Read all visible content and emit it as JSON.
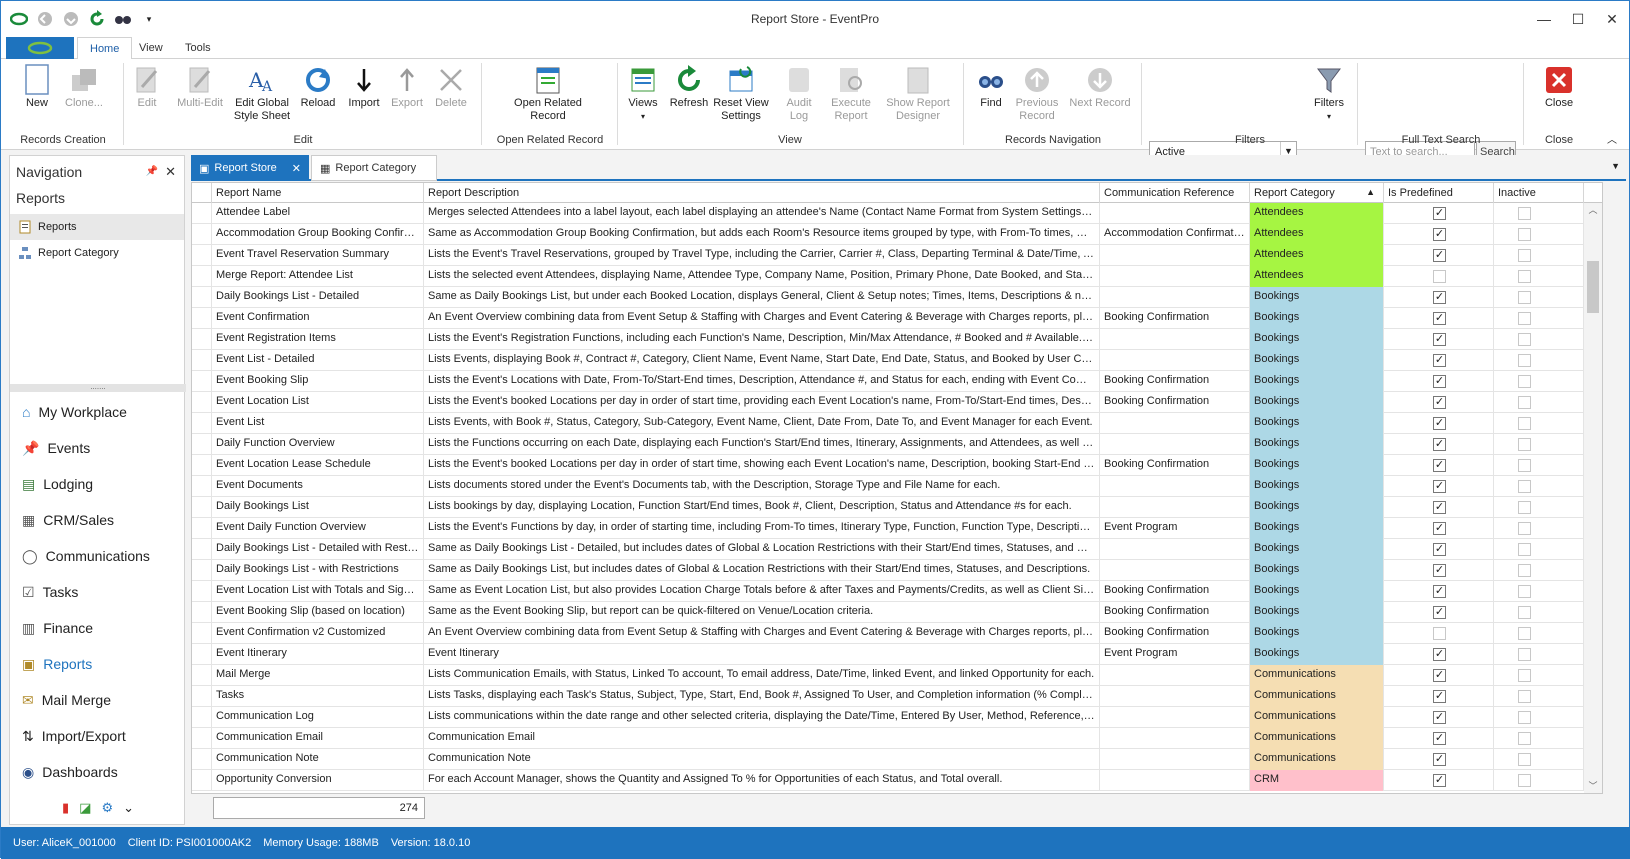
{
  "window": {
    "title": "Report Store - EventPro",
    "minimize": "—",
    "maximize": "☐",
    "close": "✕"
  },
  "menu": {
    "tabs": [
      "Home",
      "View",
      "Tools"
    ]
  },
  "ribbon": {
    "buttons": [
      {
        "key": "new",
        "label": "New",
        "disabled": false,
        "icon": "new-document-icon"
      },
      {
        "key": "clone",
        "label": "Clone...",
        "disabled": true,
        "icon": "clone-icon"
      },
      {
        "key": "edit",
        "label": "Edit",
        "disabled": true,
        "icon": "edit-icon"
      },
      {
        "key": "multi_edit",
        "label": "Multi-Edit",
        "disabled": true,
        "icon": "multi-edit-icon"
      },
      {
        "key": "edit_global",
        "label": "Edit Global Style Sheet",
        "disabled": false,
        "icon": "style-sheet-icon"
      },
      {
        "key": "reload",
        "label": "Reload",
        "disabled": false,
        "icon": "reload-icon"
      },
      {
        "key": "import",
        "label": "Import",
        "disabled": false,
        "icon": "import-icon"
      },
      {
        "key": "export",
        "label": "Export",
        "disabled": true,
        "icon": "export-icon"
      },
      {
        "key": "delete",
        "label": "Delete",
        "disabled": true,
        "icon": "delete-icon"
      },
      {
        "key": "open_related",
        "label": "Open Related Record",
        "disabled": false,
        "icon": "open-related-icon"
      },
      {
        "key": "views",
        "label": "Views",
        "disabled": false,
        "icon": "views-icon"
      },
      {
        "key": "refresh",
        "label": "Refresh",
        "disabled": false,
        "icon": "refresh-icon"
      },
      {
        "key": "reset_view",
        "label": "Reset View Settings",
        "disabled": false,
        "icon": "reset-view-icon"
      },
      {
        "key": "audit_log",
        "label": "Audit Log",
        "disabled": true,
        "icon": "audit-log-icon"
      },
      {
        "key": "execute_report",
        "label": "Execute Report",
        "disabled": true,
        "icon": "execute-report-icon"
      },
      {
        "key": "show_designer",
        "label": "Show Report Designer",
        "disabled": true,
        "icon": "report-designer-icon"
      },
      {
        "key": "find",
        "label": "Find",
        "disabled": false,
        "icon": "binoculars-icon"
      },
      {
        "key": "prev_record",
        "label": "Previous Record",
        "disabled": true,
        "icon": "up-arrow-icon"
      },
      {
        "key": "next_record",
        "label": "Next Record",
        "disabled": true,
        "icon": "down-arrow-icon"
      },
      {
        "key": "filters",
        "label": "Filters",
        "disabled": false,
        "icon": "funnel-icon"
      },
      {
        "key": "close",
        "label": "Close",
        "disabled": false,
        "icon": "close-icon"
      }
    ],
    "groups": [
      "Records Creation",
      "Edit",
      "Open Related Record",
      "View",
      "Records Navigation",
      "Filters",
      "Full Text Search",
      "Close"
    ],
    "filter_value": "Active",
    "search_placeholder": "Text to search...",
    "search_button": "Search"
  },
  "nav": {
    "title": "Navigation",
    "section": "Reports",
    "items": [
      {
        "label": "Reports",
        "icon": "report-icon"
      },
      {
        "label": "Report Category",
        "icon": "category-icon"
      }
    ],
    "modules": [
      {
        "label": "My Workplace",
        "icon": "home-icon"
      },
      {
        "label": "Events",
        "icon": "pin-icon"
      },
      {
        "label": "Lodging",
        "icon": "lodging-icon"
      },
      {
        "label": "CRM/Sales",
        "icon": "crm-icon"
      },
      {
        "label": "Communications",
        "icon": "speech-icon"
      },
      {
        "label": "Tasks",
        "icon": "tasks-icon"
      },
      {
        "label": "Finance",
        "icon": "finance-icon"
      },
      {
        "label": "Reports",
        "icon": "reports-icon"
      },
      {
        "label": "Mail Merge",
        "icon": "mail-merge-icon"
      },
      {
        "label": "Import/Export",
        "icon": "import-export-icon"
      },
      {
        "label": "Dashboards",
        "icon": "dashboard-icon"
      }
    ]
  },
  "doc_tabs": [
    {
      "label": "Report Store"
    },
    {
      "label": "Report Category"
    }
  ],
  "grid": {
    "columns": [
      "Report Name",
      "Report Description",
      "Communication Reference",
      "Report Category",
      "Is Predefined",
      "Inactive"
    ],
    "category_colors": {
      "Attendees": "#a6f542",
      "Bookings": "#add8e6",
      "Communications": "#f5deb3",
      "CRM": "#ffc0cb"
    },
    "rows": [
      {
        "name": "Attendee Label",
        "desc": "Merges selected Attendees into a label layout, each label displaying an attendee's Name (Contact Name Format from System Settings) and Pri...",
        "ref": "",
        "cat": "Attendees",
        "pre": true,
        "inactive": false
      },
      {
        "name": "Accommodation Group Booking Confirmati...",
        "desc": "Same as Accommodation Group Booking Confirmation, but adds each Room's Resource items grouped by type, with From-To times, Quantity, ...",
        "ref": "Accommodation Confirmation",
        "cat": "Attendees",
        "pre": true,
        "inactive": false
      },
      {
        "name": "Event Travel Reservation Summary",
        "desc": "Lists the Event's Travel Reservations, grouped by Travel Type, including the Carrier, Carrier #, Class, Departing Terminal & Date/Time, Arrivin...",
        "ref": "",
        "cat": "Attendees",
        "pre": true,
        "inactive": false
      },
      {
        "name": "Merge Report: Attendee List",
        "desc": "Lists the selected event Attendees, displaying Name, Attendee Type, Company Name, Position, Primary Phone, Date Booked, and Status for ...",
        "ref": "",
        "cat": "Attendees",
        "pre": false,
        "inactive": false
      },
      {
        "name": "Daily Bookings List - Detailed",
        "desc": "Same as Daily Bookings List, but under each Booked Location, displays General, Client & Setup notes; Times, Items, Descriptions & numbers fo...",
        "ref": "",
        "cat": "Bookings",
        "pre": true,
        "inactive": false
      },
      {
        "name": "Event Confirmation",
        "desc": "An Event Overview combining data from Event Setup & Staffing with Charges and Event Catering & Beverage with Charges reports, plus addi...",
        "ref": "Booking Confirmation",
        "cat": "Bookings",
        "pre": true,
        "inactive": false
      },
      {
        "name": "Event Registration Items",
        "desc": "Lists the Event's Registration Functions, including each Function's Name, Description, Min/Max Attendance, # Booked and # Available. Then lis...",
        "ref": "",
        "cat": "Bookings",
        "pre": true,
        "inactive": false
      },
      {
        "name": "Event List - Detailed",
        "desc": "Lists Events, displaying Book #, Contract #, Category, Client Name, Event Name, Start Date, End Date, Status, and Booked by User Code for...",
        "ref": "",
        "cat": "Bookings",
        "pre": true,
        "inactive": false
      },
      {
        "name": "Event Booking Slip",
        "desc": "Lists the Event's Locations with Date, From-To/Start-End times, Description, Attendance #, and Status for each, ending with Event Comments...",
        "ref": "Booking Confirmation",
        "cat": "Bookings",
        "pre": true,
        "inactive": false
      },
      {
        "name": "Event Location List",
        "desc": "Lists the Event's booked Locations per day in order of start time, providing each Event Location's name, From-To/Start-End times, Description,...",
        "ref": "Booking Confirmation",
        "cat": "Bookings",
        "pre": true,
        "inactive": false
      },
      {
        "name": "Event List",
        "desc": "Lists Events, with Book #, Status, Category, Sub-Category, Event Name, Client, Date From, Date To, and Event Manager for each Event.",
        "ref": "",
        "cat": "Bookings",
        "pre": true,
        "inactive": false
      },
      {
        "name": "Daily Function Overview",
        "desc": "Lists the Functions occurring on each Date, displaying each Function's Start/End times, Itinerary, Assignments, and Attendees, as well as the ...",
        "ref": "",
        "cat": "Bookings",
        "pre": true,
        "inactive": false
      },
      {
        "name": "Event Location Lease Schedule",
        "desc": "Lists the Event's booked Locations per day in order of start time, showing each Event Location's name, Description, booking Start-End times, A...",
        "ref": "Booking Confirmation",
        "cat": "Bookings",
        "pre": true,
        "inactive": false
      },
      {
        "name": "Event Documents",
        "desc": "Lists documents stored under the Event's Documents tab, with the Description, Storage Type and File Name for each.",
        "ref": "",
        "cat": "Bookings",
        "pre": true,
        "inactive": false
      },
      {
        "name": "Daily Bookings List",
        "desc": "Lists bookings by day, displaying Location, Function Start/End times, Book #, Client, Description, Status and Attendance #s for each.",
        "ref": "",
        "cat": "Bookings",
        "pre": true,
        "inactive": false
      },
      {
        "name": "Event Daily Function Overview",
        "desc": "Lists the Event's Functions by day, in order of starting time, including From-To times, Itinerary Type, Function, Function Type, Description, Ve...",
        "ref": "Event Program",
        "cat": "Bookings",
        "pre": true,
        "inactive": false
      },
      {
        "name": "Daily Bookings List - Detailed with Restrict...",
        "desc": "Same as Daily Bookings List - Detailed, but includes dates of Global & Location Restrictions with their Start/End times, Statuses, and Descriptions.",
        "ref": "",
        "cat": "Bookings",
        "pre": true,
        "inactive": false
      },
      {
        "name": "Daily Bookings List - with Restrictions",
        "desc": "Same as Daily Bookings List, but includes dates of Global & Location Restrictions with their Start/End times, Statuses, and Descriptions.",
        "ref": "",
        "cat": "Bookings",
        "pre": true,
        "inactive": false
      },
      {
        "name": "Event Location List with Totals and Sign Off",
        "desc": "Same as Event Location List, but also provides Location Charge Totals before & after Taxes and Payments/Credits, as well as Client Sign-off.",
        "ref": "Booking Confirmation",
        "cat": "Bookings",
        "pre": true,
        "inactive": false
      },
      {
        "name": "Event Booking Slip (based on location)",
        "desc": "Same as the Event Booking Slip, but report can be quick-filtered on Venue/Location criteria.",
        "ref": "Booking Confirmation",
        "cat": "Bookings",
        "pre": true,
        "inactive": false
      },
      {
        "name": "Event Confirmation v2 Customized",
        "desc": "An Event Overview combining data from Event Setup & Staffing with Charges and Event Catering & Beverage with Charges reports, plus addi...",
        "ref": "Booking Confirmation",
        "cat": "Bookings",
        "pre": false,
        "inactive": false
      },
      {
        "name": "Event Itinerary",
        "desc": "Event Itinerary",
        "ref": "Event Program",
        "cat": "Bookings",
        "pre": true,
        "inactive": false
      },
      {
        "name": "Mail Merge",
        "desc": "Lists Communication Emails, with Status, Linked To account, To email address, Date/Time, linked Event, and linked Opportunity for each.",
        "ref": "",
        "cat": "Communications",
        "pre": true,
        "inactive": false
      },
      {
        "name": "Tasks",
        "desc": "Lists Tasks, displaying each Task's Status, Subject, Type, Start, End, Book #, Assigned To User, and Completion information (% Complete, Co...",
        "ref": "",
        "cat": "Communications",
        "pre": true,
        "inactive": false
      },
      {
        "name": "Communication Log",
        "desc": "Lists communications within the date range and other selected criteria, displaying the Date/Time, Entered By User, Method, Reference, Subjec...",
        "ref": "",
        "cat": "Communications",
        "pre": true,
        "inactive": false
      },
      {
        "name": "Communication Email",
        "desc": "Communication Email",
        "ref": "",
        "cat": "Communications",
        "pre": true,
        "inactive": false
      },
      {
        "name": "Communication Note",
        "desc": "Communication Note",
        "ref": "",
        "cat": "Communications",
        "pre": true,
        "inactive": false
      },
      {
        "name": "Opportunity Conversion",
        "desc": "For each Account Manager, shows the Quantity and Assigned To % for Opportunities of each Status, and Total overall.",
        "ref": "",
        "cat": "CRM",
        "pre": true,
        "inactive": false
      }
    ],
    "row_count": "274"
  },
  "status": {
    "user": "User: AliceK_001000",
    "client": "Client ID: PSI001000AK2",
    "memory": "Memory Usage: 188MB",
    "version": "Version: 18.0.10"
  }
}
